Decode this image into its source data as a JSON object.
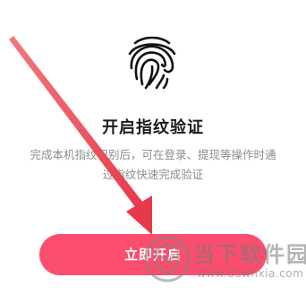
{
  "dialog": {
    "icon": "fingerprint-icon",
    "title": "开启指纹验证",
    "description_line1": "完成本机指纹识别后，可在登录、提现等操作时通",
    "description_line2": "过指纹快速完成验证",
    "button_label": "立即开启"
  },
  "watermark": {
    "name": "当下软件园",
    "url": "www.downxia.com"
  },
  "colors": {
    "accent": "#fb4e6e",
    "arrow": "#e8394a",
    "title": "#1a1a1a",
    "description": "#8c8c8c"
  }
}
